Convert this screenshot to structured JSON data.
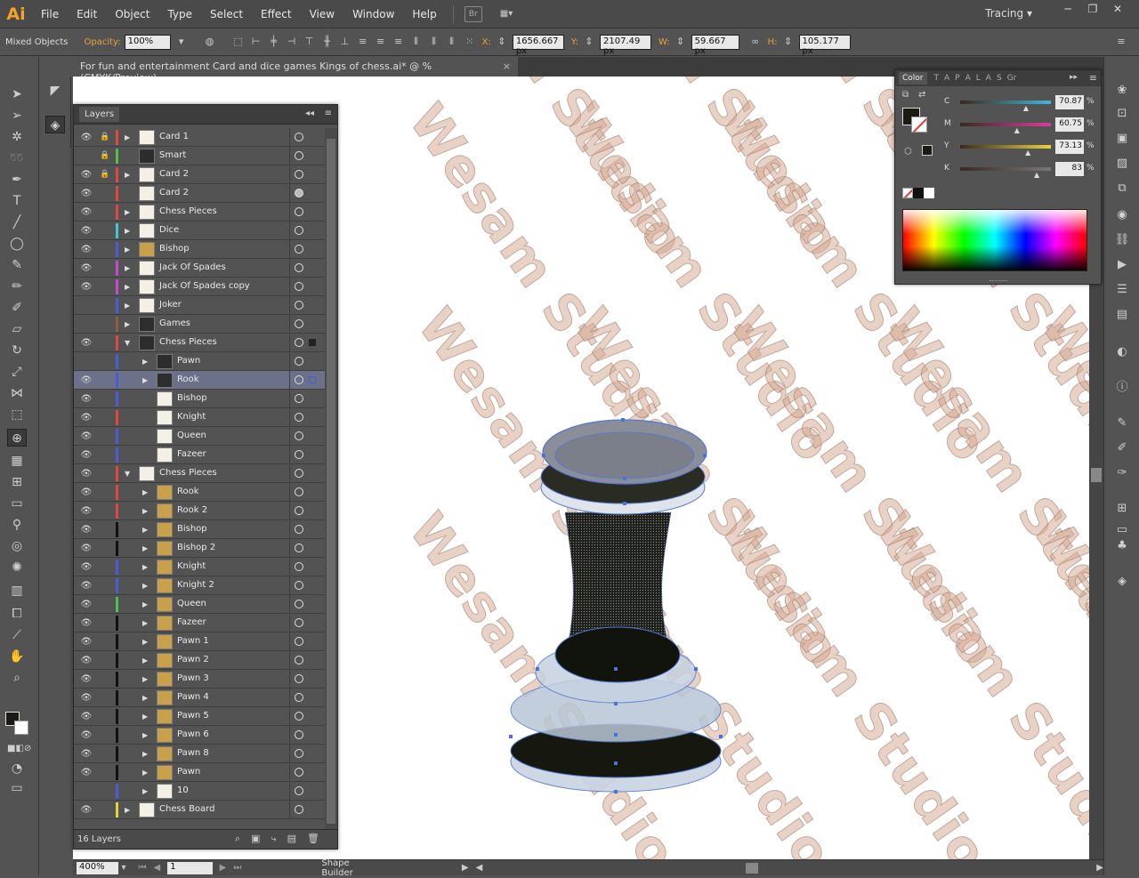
{
  "app": {
    "logo": "Ai"
  },
  "menu": [
    "File",
    "Edit",
    "Object",
    "Type",
    "Select",
    "Effect",
    "View",
    "Window",
    "Help"
  ],
  "bridge_label": "Br",
  "workspace": "Tracing",
  "control_bar": {
    "selection_label": "Mixed Objects",
    "opacity_label": "Opacity:",
    "opacity_value": "100%",
    "x_label": "X:",
    "x_value": "1656.667 px",
    "y_label": "Y:",
    "y_value": "2107.49 px",
    "w_label": "W:",
    "w_value": "59.667 px",
    "h_label": "H:",
    "h_value": "105.177 px"
  },
  "document_tab": "For fun and entertainment Card and dice games Kings of chess.ai* @ % (CMYK/Preview)",
  "layers_panel": {
    "title": "Layers",
    "footer_count": "16 Layers",
    "rows": [
      {
        "name": "Card 1",
        "eye": true,
        "lock": true,
        "color": "#e0483e",
        "indent": 0,
        "arrow": "right",
        "thumb": "light"
      },
      {
        "name": "Smart",
        "eye": false,
        "lock": true,
        "color": "#51c04c",
        "indent": 0,
        "arrow": "none",
        "thumb": "dark"
      },
      {
        "name": "Card 2",
        "eye": true,
        "lock": true,
        "color": "#e0483e",
        "indent": 0,
        "arrow": "right",
        "thumb": "light"
      },
      {
        "name": "Card 2",
        "eye": true,
        "lock": false,
        "color": "#e0483e",
        "indent": 0,
        "arrow": "none",
        "thumb": "light",
        "filled": true
      },
      {
        "name": "Chess Pieces",
        "eye": true,
        "lock": false,
        "color": "#e0483e",
        "indent": 0,
        "arrow": "right",
        "thumb": "light"
      },
      {
        "name": "Dice",
        "eye": true,
        "lock": false,
        "color": "#3fc7d9",
        "indent": 0,
        "arrow": "right",
        "thumb": "light"
      },
      {
        "name": "Bishop",
        "eye": true,
        "lock": false,
        "color": "#4a5bd6",
        "indent": 0,
        "arrow": "right",
        "thumb": "gold"
      },
      {
        "name": "Jack Of Spades",
        "eye": true,
        "lock": false,
        "color": "#c24bd4",
        "indent": 0,
        "arrow": "right",
        "thumb": "light"
      },
      {
        "name": "Jack Of Spades copy",
        "eye": true,
        "lock": false,
        "color": "#c24bd4",
        "indent": 0,
        "arrow": "right",
        "thumb": "light"
      },
      {
        "name": "Joker",
        "eye": false,
        "lock": false,
        "color": "#4a5bd6",
        "indent": 0,
        "arrow": "right",
        "thumb": "light"
      },
      {
        "name": "Games",
        "eye": false,
        "lock": false,
        "color": "#8a6040",
        "indent": 0,
        "arrow": "right",
        "thumb": "dark"
      },
      {
        "name": "Chess Pieces",
        "eye": true,
        "lock": false,
        "color": "#e0483e",
        "indent": 0,
        "arrow": "down",
        "thumb": "dark",
        "sel": "#222"
      },
      {
        "name": "Pawn",
        "eye": false,
        "lock": false,
        "color": "#4a5bd6",
        "indent": 1,
        "arrow": "right",
        "thumb": "dark"
      },
      {
        "name": "Rook",
        "eye": true,
        "lock": false,
        "color": "#4a5bd6",
        "indent": 1,
        "arrow": "right",
        "thumb": "dark",
        "selected": true,
        "sel": "#4a5bd6"
      },
      {
        "name": "Bishop",
        "eye": true,
        "lock": false,
        "color": "#4a5bd6",
        "indent": 1,
        "arrow": "none",
        "thumb": "light"
      },
      {
        "name": "Knight",
        "eye": true,
        "lock": false,
        "color": "#e0483e",
        "indent": 1,
        "arrow": "none",
        "thumb": "white"
      },
      {
        "name": "Queen",
        "eye": true,
        "lock": false,
        "color": "#4a5bd6",
        "indent": 1,
        "arrow": "none",
        "thumb": "white"
      },
      {
        "name": "Fazeer",
        "eye": true,
        "lock": false,
        "color": "#4a5bd6",
        "indent": 1,
        "arrow": "none",
        "thumb": "white"
      },
      {
        "name": "Chess Pieces",
        "eye": true,
        "lock": false,
        "color": "#e0483e",
        "indent": 0,
        "arrow": "down",
        "thumb": "light"
      },
      {
        "name": "Rook",
        "eye": true,
        "lock": false,
        "color": "#e0483e",
        "indent": 1,
        "arrow": "right",
        "thumb": "gold"
      },
      {
        "name": "Rook 2",
        "eye": true,
        "lock": false,
        "color": "#e0483e",
        "indent": 1,
        "arrow": "right",
        "thumb": "gold"
      },
      {
        "name": "Bishop",
        "eye": true,
        "lock": false,
        "color": "#111111",
        "indent": 1,
        "arrow": "right",
        "thumb": "gold"
      },
      {
        "name": "Bishop 2",
        "eye": true,
        "lock": false,
        "color": "#111111",
        "indent": 1,
        "arrow": "right",
        "thumb": "gold"
      },
      {
        "name": "Knight",
        "eye": true,
        "lock": false,
        "color": "#4a5bd6",
        "indent": 1,
        "arrow": "right",
        "thumb": "gold"
      },
      {
        "name": "Knight 2",
        "eye": true,
        "lock": false,
        "color": "#4a5bd6",
        "indent": 1,
        "arrow": "right",
        "thumb": "gold"
      },
      {
        "name": "Queen",
        "eye": true,
        "lock": false,
        "color": "#51c04c",
        "indent": 1,
        "arrow": "right",
        "thumb": "gold"
      },
      {
        "name": "Fazeer",
        "eye": true,
        "lock": false,
        "color": "#111111",
        "indent": 1,
        "arrow": "right",
        "thumb": "gold"
      },
      {
        "name": "Pawn 1",
        "eye": true,
        "lock": false,
        "color": "#111111",
        "indent": 1,
        "arrow": "right",
        "thumb": "gold"
      },
      {
        "name": "Pawn 2",
        "eye": true,
        "lock": false,
        "color": "#111111",
        "indent": 1,
        "arrow": "right",
        "thumb": "gold"
      },
      {
        "name": "Pawn 3",
        "eye": true,
        "lock": false,
        "color": "#111111",
        "indent": 1,
        "arrow": "right",
        "thumb": "gold"
      },
      {
        "name": "Pawn 4",
        "eye": true,
        "lock": false,
        "color": "#111111",
        "indent": 1,
        "arrow": "right",
        "thumb": "gold"
      },
      {
        "name": "Pawn 5",
        "eye": true,
        "lock": false,
        "color": "#111111",
        "indent": 1,
        "arrow": "right",
        "thumb": "gold"
      },
      {
        "name": "Pawn 6",
        "eye": true,
        "lock": false,
        "color": "#111111",
        "indent": 1,
        "arrow": "right",
        "thumb": "gold"
      },
      {
        "name": "Pawn 8",
        "eye": true,
        "lock": false,
        "color": "#111111",
        "indent": 1,
        "arrow": "right",
        "thumb": "gold"
      },
      {
        "name": "Pawn",
        "eye": true,
        "lock": false,
        "color": "#111111",
        "indent": 1,
        "arrow": "right",
        "thumb": "gold"
      },
      {
        "name": "10",
        "eye": false,
        "lock": false,
        "color": "#4a5bd6",
        "indent": 1,
        "arrow": "right",
        "thumb": "light"
      },
      {
        "name": "Chess Board",
        "eye": true,
        "lock": false,
        "color": "#e8d23c",
        "indent": 0,
        "arrow": "right",
        "thumb": "light"
      }
    ]
  },
  "color_panel": {
    "tabs": [
      "Color",
      "T",
      "A",
      "P",
      "A",
      "L",
      "A",
      "S",
      "Gr"
    ],
    "sliders": [
      {
        "label": "C",
        "value": "70.87",
        "color": "#3fb7d9"
      },
      {
        "label": "M",
        "value": "60.75",
        "color": "#d93f9c"
      },
      {
        "label": "Y",
        "value": "73.13",
        "color": "#e8d23c"
      },
      {
        "label": "K",
        "value": "83",
        "color": "#777777"
      }
    ],
    "percent": "%"
  },
  "status_bar": {
    "zoom": "400%",
    "page": "1",
    "tool": "Shape Builder"
  },
  "watermark_text": "Wesam Studio",
  "accent_colors": {
    "ai_orange": "#f7a12b",
    "selection_blue": "#4a72d6",
    "ui_bg": "#535353"
  }
}
